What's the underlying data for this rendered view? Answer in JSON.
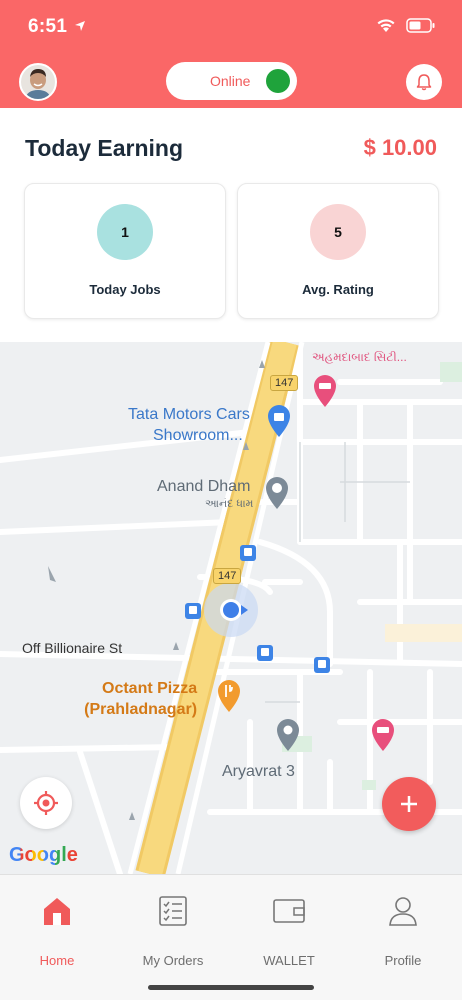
{
  "status_bar": {
    "time": "6:51"
  },
  "header": {
    "online_label": "Online"
  },
  "earnings": {
    "title": "Today Earning",
    "amount": "$ 10.00",
    "cards": [
      {
        "value": "1",
        "label": "Today Jobs"
      },
      {
        "value": "5",
        "label": "Avg. Rating"
      }
    ]
  },
  "map": {
    "labels": {
      "gujarati_city": "અહમદાબાદ સિટી...",
      "tata_line1": "Tata Motors Cars",
      "tata_line2": "Showroom...",
      "anand_dham": "Anand Dham",
      "anand_dham_gu": "આનંદ ધામ",
      "off_billionaire": "Off Billionaire St",
      "octant_line1": "Octant Pizza",
      "octant_line2": "(Prahladnagar)",
      "aryavrat": "Aryavrat 3",
      "route_147": "147",
      "google": "Google"
    }
  },
  "nav": {
    "items": [
      {
        "label": "Home"
      },
      {
        "label": "My Orders"
      },
      {
        "label": "WALLET"
      },
      {
        "label": "Profile"
      }
    ]
  },
  "colors": {
    "accent": "#fa6767",
    "online": "#1fa33b"
  }
}
